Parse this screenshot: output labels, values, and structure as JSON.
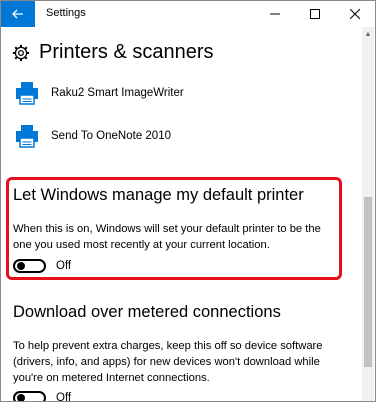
{
  "window": {
    "title": "Settings",
    "back_icon": "arrow-left-icon",
    "controls": [
      "minimize-icon",
      "maximize-icon",
      "close-icon"
    ]
  },
  "page": {
    "title": "Printers & scanners",
    "icon": "gear-icon"
  },
  "printers": [
    {
      "name": "Raku2 Smart ImageWriter",
      "icon": "printer-icon"
    },
    {
      "name": "Send To OneNote 2010",
      "icon": "printer-icon"
    }
  ],
  "default_printer": {
    "heading": "Let Windows manage my default printer",
    "description": "When this is on, Windows will set your default printer to be the one you used most recently at your current location.",
    "toggle_state": "Off"
  },
  "metered": {
    "heading": "Download over metered connections",
    "description": "To help prevent extra charges, keep this off so device software (drivers, info, and apps) for new devices won't download while you're on metered Internet connections.",
    "toggle_state": "Off"
  },
  "colors": {
    "accent": "#0078d7",
    "highlight": "#e3111b"
  }
}
